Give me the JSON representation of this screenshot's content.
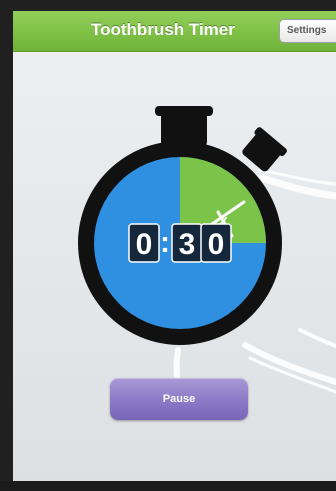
{
  "navbar": {
    "title": "Toothbrush Timer",
    "settings_label": "Settings"
  },
  "timer": {
    "display": {
      "minutes": "0",
      "separator": ":",
      "tens": "3",
      "ones": "0"
    },
    "elapsed_fraction": 0.25,
    "colors": {
      "face": "#2f8fe0",
      "elapsed": "#7cc34a",
      "rim": "#111111"
    }
  },
  "controls": {
    "pause_label": "Pause"
  }
}
